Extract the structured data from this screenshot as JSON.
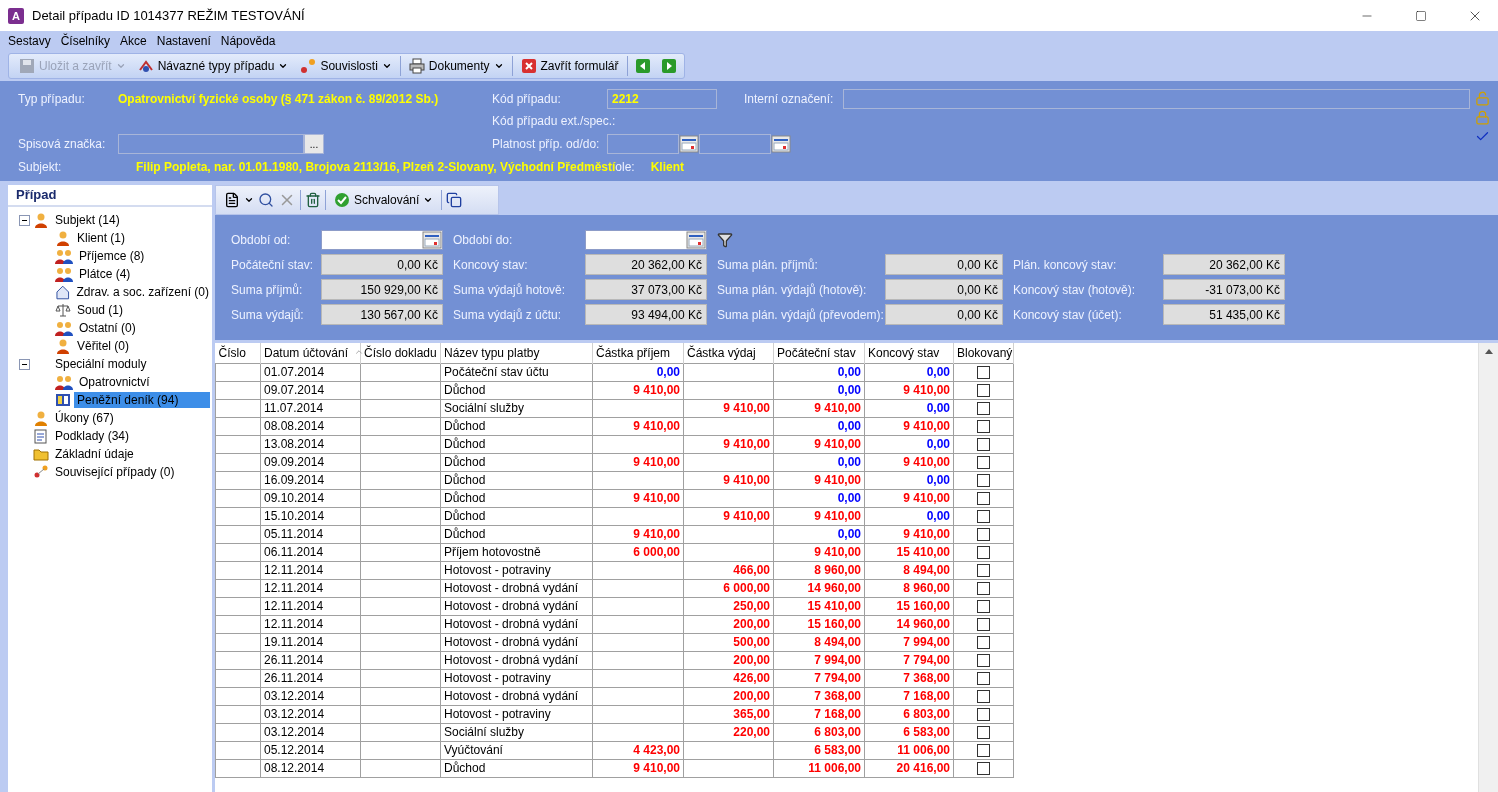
{
  "window": {
    "app_icon": "A",
    "title": "Detail případu ID 1014377 REŽIM TESTOVÁNÍ"
  },
  "menu": [
    "Sestavy",
    "Číselníky",
    "Akce",
    "Nastavení",
    "Nápověda"
  ],
  "toolbar": [
    {
      "label": "Uložit a zavřít",
      "dropdown": true,
      "disabled": true
    },
    {
      "label": "Návazné typy případu",
      "dropdown": true,
      "disabled": false
    },
    {
      "label": "Souvislosti",
      "dropdown": true,
      "disabled": false
    },
    {
      "label": "Dokumenty",
      "dropdown": true,
      "disabled": false
    },
    {
      "label": "Zavřít formulář",
      "dropdown": false,
      "disabled": false
    }
  ],
  "header": {
    "case_type_label": "Typ případu:",
    "case_type": "Opatrovnictví fyzické osoby (§ 471 zákon č. 89/2012 Sb.)",
    "case_code_label": "Kód případu:",
    "case_code": "2212",
    "internal_label": "Interní označení:",
    "ext_code_label": "Kód případu ext./spec.:",
    "file_mark_label": "Spisová značka:",
    "file_mark_button": "...",
    "validity_label": "Platnost příp. od/do:",
    "subject_label": "Subjekt:",
    "subject": "Filip Popleta, nar. 01.01.1980, Brojova 2113/16, Plzeň 2-Slovany, Východní Předměstí",
    "role_label": "ole:",
    "role": "Klient"
  },
  "sidebar": {
    "title": "Případ",
    "tree": [
      {
        "label": "Subjekt  (14)",
        "selected": false,
        "expanded": true,
        "children": [
          {
            "label": "Klient  (1)",
            "selected": false
          },
          {
            "label": "Příjemce  (8)",
            "selected": false
          },
          {
            "label": "Plátce  (4)",
            "selected": false
          },
          {
            "label": "Zdrav. a soc. zařízení  (0)",
            "selected": false
          },
          {
            "label": "Soud  (1)",
            "selected": false
          },
          {
            "label": "Ostatní  (0)",
            "selected": false
          },
          {
            "label": "Věřitel  (0)",
            "selected": false
          }
        ]
      },
      {
        "label": "Speciální moduly",
        "selected": false,
        "expanded": true,
        "children": [
          {
            "label": "Opatrovnictví",
            "selected": false
          },
          {
            "label": "Peněžní deník  (94)",
            "selected": true
          }
        ]
      },
      {
        "label": "Úkony  (67)",
        "selected": false
      },
      {
        "label": "Podklady  (34)",
        "selected": false
      },
      {
        "label": "Základní údaje",
        "selected": false
      },
      {
        "label": "Související případy  (0)",
        "selected": false
      }
    ]
  },
  "sub_toolbar": {
    "approval": "Schvalování"
  },
  "filter": {
    "from_label": "Období od:",
    "to_label": "Období do:",
    "summary": [
      [
        {
          "label": "Počáteční stav:",
          "value": "0,00 Kč"
        },
        {
          "label": "Koncový stav:",
          "value": "20 362,00 Kč"
        },
        {
          "label": "Suma plán. příjmů:",
          "value": "0,00 Kč"
        },
        {
          "label": "Plán. koncový stav:",
          "value": "20 362,00 Kč"
        }
      ],
      [
        {
          "label": "Suma příjmů:",
          "value": "150 929,00 Kč"
        },
        {
          "label": "Suma výdajů hotově:",
          "value": "37 073,00 Kč"
        },
        {
          "label": "Suma plán. výdajů (hotově):",
          "value": "0,00 Kč"
        },
        {
          "label": "Koncový stav (hotově):",
          "value": "-31 073,00 Kč"
        }
      ],
      [
        {
          "label": "Suma výdajů:",
          "value": "130 567,00 Kč"
        },
        {
          "label": "Suma výdajů z účtu:",
          "value": "93 494,00 Kč"
        },
        {
          "label": "Suma plán. výdajů (převodem):",
          "value": "0,00 Kč"
        },
        {
          "label": "Koncový stav (účet):",
          "value": "51 435,00 Kč"
        }
      ]
    ]
  },
  "table": {
    "columns": [
      "Číslo",
      "Datum účtování",
      "Číslo dokladu",
      "Název typu platby",
      "Částka příjem",
      "Částka výdaj",
      "Počáteční stav",
      "Koncový stav",
      "Blokovaný"
    ],
    "rows": [
      {
        "date": "01.07.2014",
        "type": "Počáteční stav účtu",
        "income": {
          "v": "0,00",
          "color": "#0000ff"
        },
        "start": {
          "v": "0,00",
          "color": "#0000ff"
        },
        "end": {
          "v": "0,00",
          "color": "#0000ff"
        },
        "blocked": false
      },
      {
        "date": "09.07.2014",
        "type": "Důchod",
        "income": {
          "v": "9 410,00",
          "color": "#ff0000"
        },
        "start": {
          "v": "0,00",
          "color": "#0000ff"
        },
        "end": {
          "v": "9 410,00",
          "color": "#ff0000"
        },
        "blocked": false
      },
      {
        "date": "11.07.2014",
        "type": "Sociální služby",
        "expense": {
          "v": "9 410,00",
          "color": "#ff0000"
        },
        "start": {
          "v": "9 410,00",
          "color": "#ff0000"
        },
        "end": {
          "v": "0,00",
          "color": "#0000ff"
        },
        "blocked": false
      },
      {
        "date": "08.08.2014",
        "type": "Důchod",
        "income": {
          "v": "9 410,00",
          "color": "#ff0000"
        },
        "start": {
          "v": "0,00",
          "color": "#0000ff"
        },
        "end": {
          "v": "9 410,00",
          "color": "#ff0000"
        },
        "blocked": false
      },
      {
        "date": "13.08.2014",
        "type": "Důchod",
        "expense": {
          "v": "9 410,00",
          "color": "#ff0000"
        },
        "start": {
          "v": "9 410,00",
          "color": "#ff0000"
        },
        "end": {
          "v": "0,00",
          "color": "#0000ff"
        },
        "blocked": false
      },
      {
        "date": "09.09.2014",
        "type": "Důchod",
        "income": {
          "v": "9 410,00",
          "color": "#ff0000"
        },
        "start": {
          "v": "0,00",
          "color": "#0000ff"
        },
        "end": {
          "v": "9 410,00",
          "color": "#ff0000"
        },
        "blocked": false
      },
      {
        "date": "16.09.2014",
        "type": "Důchod",
        "expense": {
          "v": "9 410,00",
          "color": "#ff0000"
        },
        "start": {
          "v": "9 410,00",
          "color": "#ff0000"
        },
        "end": {
          "v": "0,00",
          "color": "#0000ff"
        },
        "blocked": false
      },
      {
        "date": "09.10.2014",
        "type": "Důchod",
        "income": {
          "v": "9 410,00",
          "color": "#ff0000"
        },
        "start": {
          "v": "0,00",
          "color": "#0000ff"
        },
        "end": {
          "v": "9 410,00",
          "color": "#ff0000"
        },
        "blocked": false
      },
      {
        "date": "15.10.2014",
        "type": "Důchod",
        "expense": {
          "v": "9 410,00",
          "color": "#ff0000"
        },
        "start": {
          "v": "9 410,00",
          "color": "#ff0000"
        },
        "end": {
          "v": "0,00",
          "color": "#0000ff"
        },
        "blocked": false
      },
      {
        "date": "05.11.2014",
        "type": "Důchod",
        "income": {
          "v": "9 410,00",
          "color": "#ff0000"
        },
        "start": {
          "v": "0,00",
          "color": "#0000ff"
        },
        "end": {
          "v": "9 410,00",
          "color": "#ff0000"
        },
        "blocked": false
      },
      {
        "date": "06.11.2014",
        "type": "Příjem hotovostně",
        "income": {
          "v": "6 000,00",
          "color": "#ff0000"
        },
        "start": {
          "v": "9 410,00",
          "color": "#ff0000"
        },
        "end": {
          "v": "15 410,00",
          "color": "#ff0000"
        },
        "blocked": false
      },
      {
        "date": "12.11.2014",
        "type": "Hotovost - potraviny",
        "expense": {
          "v": "466,00",
          "color": "#ff0000"
        },
        "start": {
          "v": "8 960,00",
          "color": "#ff0000"
        },
        "end": {
          "v": "8 494,00",
          "color": "#ff0000"
        },
        "blocked": false
      },
      {
        "date": "12.11.2014",
        "type": "Hotovost - drobná vydání",
        "expense": {
          "v": "6 000,00",
          "color": "#ff0000"
        },
        "start": {
          "v": "14 960,00",
          "color": "#ff0000"
        },
        "end": {
          "v": "8 960,00",
          "color": "#ff0000"
        },
        "blocked": false
      },
      {
        "date": "12.11.2014",
        "type": "Hotovost - drobná vydání",
        "expense": {
          "v": "250,00",
          "color": "#ff0000"
        },
        "start": {
          "v": "15 410,00",
          "color": "#ff0000"
        },
        "end": {
          "v": "15 160,00",
          "color": "#ff0000"
        },
        "blocked": false
      },
      {
        "date": "12.11.2014",
        "type": "Hotovost - drobná vydání",
        "expense": {
          "v": "200,00",
          "color": "#ff0000"
        },
        "start": {
          "v": "15 160,00",
          "color": "#ff0000"
        },
        "end": {
          "v": "14 960,00",
          "color": "#ff0000"
        },
        "blocked": false
      },
      {
        "date": "19.11.2014",
        "type": "Hotovost - drobná vydání",
        "expense": {
          "v": "500,00",
          "color": "#ff0000"
        },
        "start": {
          "v": "8 494,00",
          "color": "#ff0000"
        },
        "end": {
          "v": "7 994,00",
          "color": "#ff0000"
        },
        "blocked": false
      },
      {
        "date": "26.11.2014",
        "type": "Hotovost - drobná vydání",
        "expense": {
          "v": "200,00",
          "color": "#ff0000"
        },
        "start": {
          "v": "7 994,00",
          "color": "#ff0000"
        },
        "end": {
          "v": "7 794,00",
          "color": "#ff0000"
        },
        "blocked": false
      },
      {
        "date": "26.11.2014",
        "type": "Hotovost - potraviny",
        "expense": {
          "v": "426,00",
          "color": "#ff0000"
        },
        "start": {
          "v": "7 794,00",
          "color": "#ff0000"
        },
        "end": {
          "v": "7 368,00",
          "color": "#ff0000"
        },
        "blocked": false
      },
      {
        "date": "03.12.2014",
        "type": "Hotovost - drobná vydání",
        "expense": {
          "v": "200,00",
          "color": "#ff0000"
        },
        "start": {
          "v": "7 368,00",
          "color": "#ff0000"
        },
        "end": {
          "v": "7 168,00",
          "color": "#ff0000"
        },
        "blocked": false
      },
      {
        "date": "03.12.2014",
        "type": "Hotovost - potraviny",
        "expense": {
          "v": "365,00",
          "color": "#ff0000"
        },
        "start": {
          "v": "7 168,00",
          "color": "#ff0000"
        },
        "end": {
          "v": "6 803,00",
          "color": "#ff0000"
        },
        "blocked": false
      },
      {
        "date": "03.12.2014",
        "type": "Sociální služby",
        "expense": {
          "v": "220,00",
          "color": "#ff0000"
        },
        "start": {
          "v": "6 803,00",
          "color": "#ff0000"
        },
        "end": {
          "v": "6 583,00",
          "color": "#ff0000"
        },
        "blocked": false
      },
      {
        "date": "05.12.2014",
        "type": "Vyúčtování",
        "income": {
          "v": "4 423,00",
          "color": "#ff0000"
        },
        "start": {
          "v": "6 583,00",
          "color": "#ff0000"
        },
        "end": {
          "v": "11 006,00",
          "color": "#ff0000"
        },
        "blocked": false
      },
      {
        "date": "08.12.2014",
        "type": "Důchod",
        "income": {
          "v": "9 410,00",
          "color": "#ff0000"
        },
        "start": {
          "v": "11 006,00",
          "color": "#ff0000"
        },
        "end": {
          "v": "20 416,00",
          "color": "#ff0000"
        },
        "blocked": false
      }
    ]
  }
}
